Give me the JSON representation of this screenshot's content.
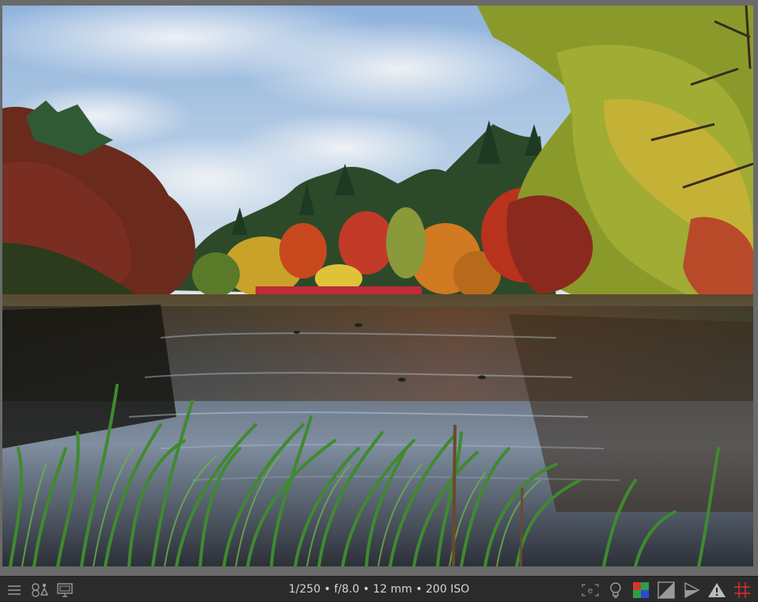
{
  "viewer": {
    "image_name": "autumn-pond-photo"
  },
  "bottombar": {
    "exif_text": "1/250 • f/8.0 • 12 mm • 200 ISO",
    "left_icons": [
      "hamburger-menu-icon",
      "shapes-icon",
      "display-icon"
    ],
    "right_icons": [
      "focus-peaking-icon",
      "lightbulb-icon",
      "color-assessment-icon",
      "overexposure-icon",
      "softproof-icon",
      "gamut-warning-icon",
      "guides-icon"
    ],
    "accent_colors": {
      "red": "#d13a2a",
      "green": "#2aa04a",
      "blue": "#2a4ad1",
      "guides": "#e03030"
    }
  }
}
